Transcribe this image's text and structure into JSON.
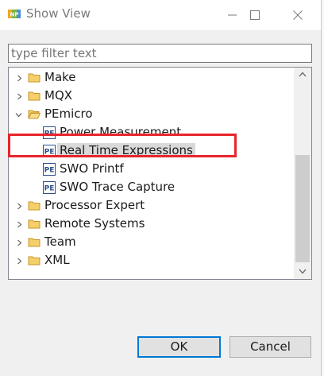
{
  "window": {
    "title": "Show View",
    "app_icon": "nxp-logo-icon",
    "controls": [
      "minimize-icon",
      "maximize-icon",
      "close-icon"
    ]
  },
  "filter": {
    "placeholder": "type filter text",
    "value": ""
  },
  "tree": {
    "items": [
      {
        "label": "Make",
        "type": "folder",
        "expanded": false
      },
      {
        "label": "MQX",
        "type": "folder",
        "expanded": false
      },
      {
        "label": "PEmicro",
        "type": "folder",
        "expanded": true
      },
      {
        "label": "Power Measurement",
        "type": "view",
        "icon": "pe-view-icon"
      },
      {
        "label": "Real Time Expressions",
        "type": "view",
        "icon": "pe-view-icon",
        "selected": true
      },
      {
        "label": "SWO Printf",
        "type": "view",
        "icon": "pe-view-icon"
      },
      {
        "label": "SWO Trace Capture",
        "type": "view",
        "icon": "pe-view-icon"
      },
      {
        "label": "Processor Expert",
        "type": "folder",
        "expanded": false
      },
      {
        "label": "Remote Systems",
        "type": "folder",
        "expanded": false
      },
      {
        "label": "Team",
        "type": "folder",
        "expanded": false
      },
      {
        "label": "XML",
        "type": "folder",
        "expanded": false
      }
    ]
  },
  "buttons": {
    "ok": "OK",
    "cancel": "Cancel"
  },
  "colors": {
    "highlight_border": "#e8252b",
    "folder": "#e8b84a",
    "default_button_border": "#0078d7"
  }
}
